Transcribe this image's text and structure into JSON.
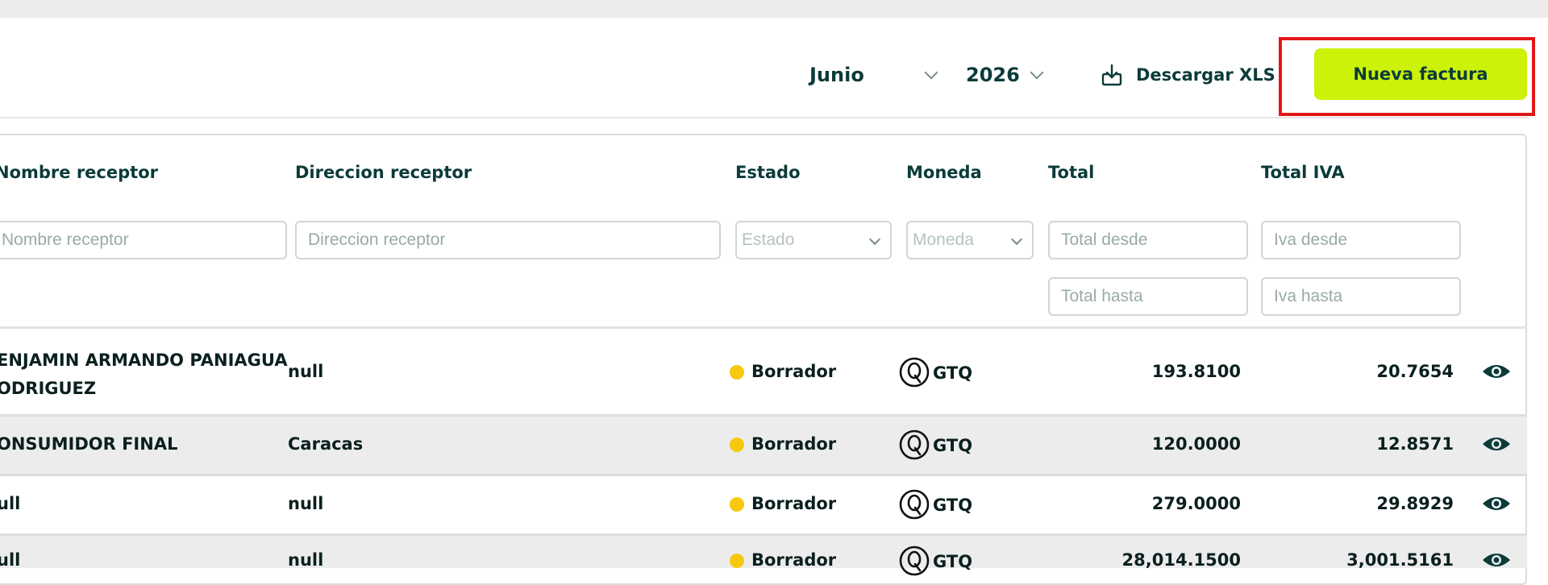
{
  "toolbar": {
    "month": "Junio",
    "year": "2026",
    "download_label": "Descargar XLS",
    "new_invoice_label": "Nueva factura"
  },
  "table": {
    "columns": {
      "receiver_name": "Nombre receptor",
      "receiver_address": "Direccion receptor",
      "status": "Estado",
      "currency": "Moneda",
      "total": "Total",
      "total_iva": "Total IVA"
    },
    "filters": {
      "receiver_name_placeholder": "Nombre receptor",
      "receiver_address_placeholder": "Direccion receptor",
      "status_placeholder": "Estado",
      "currency_placeholder": "Moneda",
      "total_from_placeholder": "Total desde",
      "total_to_placeholder": "Total hasta",
      "iva_from_placeholder": "Iva desde",
      "iva_to_placeholder": "Iva hasta"
    },
    "rows": [
      {
        "name_line1": "ENJAMIN ARMANDO PANIAGUA",
        "name_line2": "ODRIGUEZ",
        "address": "null",
        "status": "Borrador",
        "currency": "GTQ",
        "total": "193.8100",
        "total_iva": "20.7654"
      },
      {
        "name_line1": "ONSUMIDOR FINAL",
        "address": "Caracas",
        "status": "Borrador",
        "currency": "GTQ",
        "total": "120.0000",
        "total_iva": "12.8571"
      },
      {
        "name_line1": "ull",
        "address": "null",
        "status": "Borrador",
        "currency": "GTQ",
        "total": "279.0000",
        "total_iva": "29.8929"
      },
      {
        "name_line1": "ull",
        "address": "null",
        "status": "Borrador",
        "currency": "GTQ",
        "total": "28,014.1500",
        "total_iva": "3,001.5161"
      }
    ]
  },
  "colors": {
    "accent": "#ccf20a",
    "highlight": "#e01818",
    "status_draft": "#f6c90e",
    "text_dark": "#0b3b3a"
  }
}
